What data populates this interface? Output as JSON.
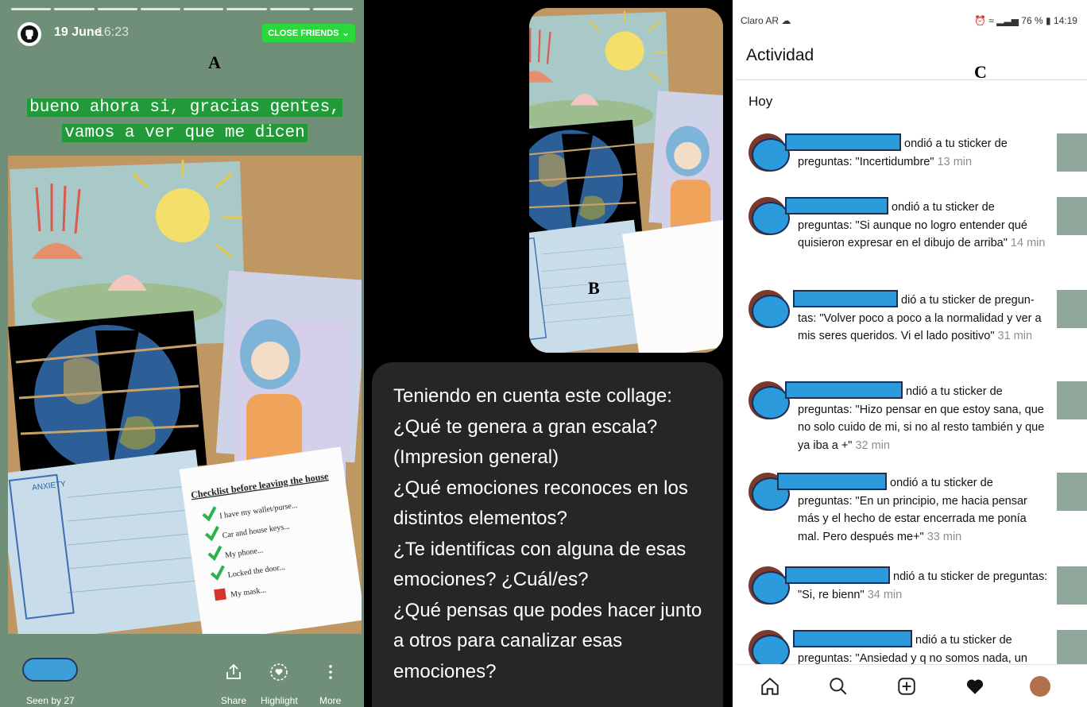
{
  "panel_labels": {
    "a": "A",
    "b": "B",
    "c": "C"
  },
  "story": {
    "date": "19 June",
    "time": "16:23",
    "audience_button": "CLOSE FRIENDS",
    "caption_line1": "bueno ahora si, gracias gentes,",
    "caption_line2": "vamos a ver que me dicen",
    "checklist": {
      "title": "Checklist before leaving the house",
      "items": [
        "I have my wallet/purse...",
        "Car and house keys...",
        "My phone...",
        "Locked the door...",
        "My mask..."
      ]
    },
    "notebook_label": "ANXIETY",
    "seen_by": "Seen by 27",
    "actions": [
      "Share",
      "Highlight",
      "More"
    ]
  },
  "question_box": {
    "lines": [
      "Teniendo en cuenta este collage:",
      "¿Qué te genera a gran escala?",
      "(Impresion general)",
      "¿Qué emociones reconoces en los",
      "distintos elementos?",
      "¿Te identificas con alguna de esas",
      "emociones? ¿Cuál/es?",
      "¿Qué pensas que podes hacer junto",
      "a otros para canalizar esas",
      "emociones?"
    ]
  },
  "activity": {
    "status_bar": {
      "carrier": "Claro AR",
      "battery": "76 %",
      "clock": "14:19"
    },
    "title": "Actividad",
    "section": "Hoy",
    "notifications": [
      {
        "text": "ondió a tu sticker de preguntas: \"Incertidumbre\"",
        "time": "13 min"
      },
      {
        "text": "ondió a tu sticker de preguntas: \"Si aunque no logro entender qué quisieron expresar en el dibujo de arriba\"",
        "time": "14 min"
      },
      {
        "text": "dió a tu sticker de pregun-tas: \"Volver poco a poco a la normalidad y ver a mis seres queridos. Vi el lado positivo\"",
        "time": "31 min"
      },
      {
        "text": "ndió a tu sticker de preguntas: \"Hizo pensar en que estoy sana, que no solo cuido de mi, si no al resto también y que ya iba a +\"",
        "time": "32 min"
      },
      {
        "text": "ondió a tu sticker de preguntas: \"En un principio, me hacia pensar más y el hecho de estar encerrada me ponía mal. Pero después me+\"",
        "time": "33 min"
      },
      {
        "text": "ndió a tu sticker de preguntas: \"Si, re bienn\"",
        "time": "34 min"
      },
      {
        "text": "ndió a tu sticker de preguntas: \"Ansiedad y q no somos nada, un",
        "time": ""
      }
    ],
    "nav_icons": [
      "home-icon",
      "search-icon",
      "add-icon",
      "heart-icon",
      "profile-icon"
    ]
  },
  "colors": {
    "story_bg": "#6f8f79",
    "close_friends": "#2bd83c",
    "caption_bg": "#239a3a",
    "redaction": "#2b9bdb",
    "bubble_bg": "#262626"
  }
}
